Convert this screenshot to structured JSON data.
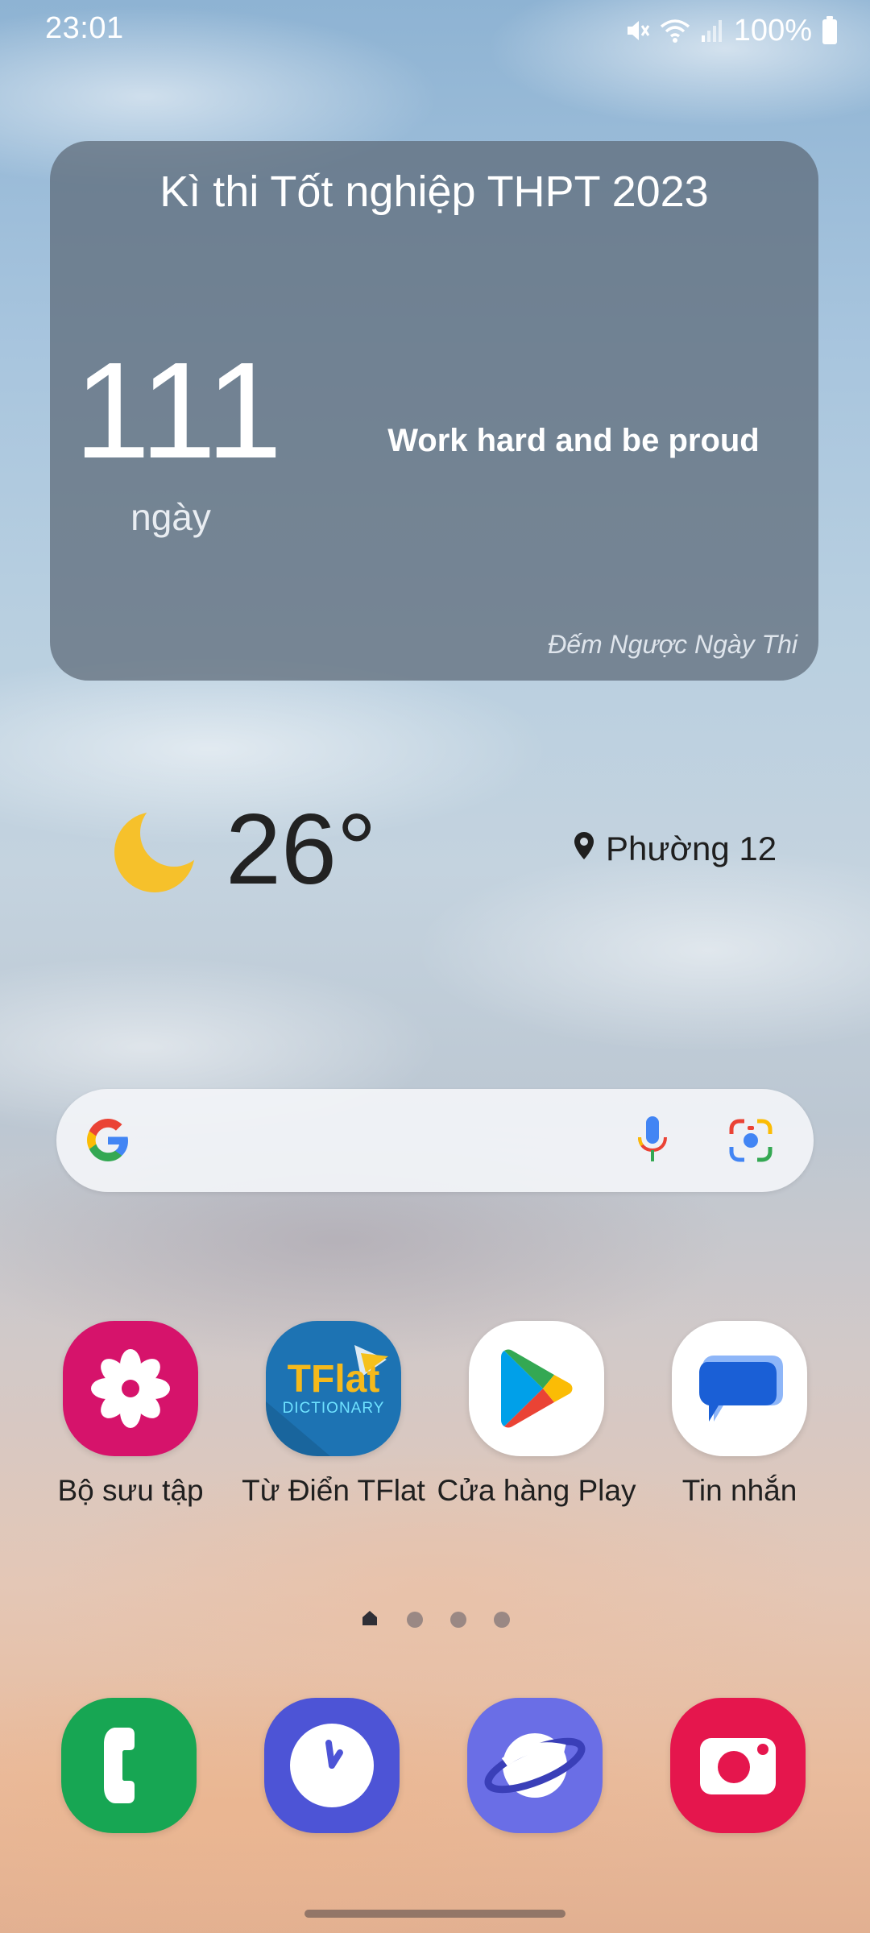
{
  "status_bar": {
    "time": "23:01",
    "battery_text": "100%",
    "icons": [
      "mute-icon",
      "wifi-icon",
      "signal-icon",
      "battery-icon"
    ]
  },
  "countdown_widget": {
    "title": "Kì thi Tốt nghiệp THPT 2023",
    "days": "111",
    "unit": "ngày",
    "motto": "Work hard and be proud",
    "app_name": "Đếm Ngược Ngày Thi"
  },
  "weather_widget": {
    "icon": "moon-icon",
    "temperature": "26°",
    "location": "Phường 12"
  },
  "search_bar": {
    "icons": [
      "google-logo-icon",
      "microphone-icon",
      "google-lens-icon"
    ]
  },
  "apps": [
    {
      "label": "Bộ sưu tập",
      "icon": "gallery-icon",
      "color": "#d6136b"
    },
    {
      "label": "Từ Điển TFlat",
      "icon": "tflat-dictionary-icon",
      "color": "#1d73b3",
      "icon_text_top": "TFlat",
      "icon_text_bottom": "DICTIONARY"
    },
    {
      "label": "Cửa hàng Play",
      "icon": "play-store-icon",
      "color": "#ffffff"
    },
    {
      "label": "Tin nhắn",
      "icon": "messages-icon",
      "color": "#ffffff"
    }
  ],
  "dock": [
    {
      "name": "phone",
      "icon": "phone-icon",
      "color": "#17a653"
    },
    {
      "name": "clock",
      "icon": "clock-icon",
      "color": "#4d54d6"
    },
    {
      "name": "internet",
      "icon": "internet-icon",
      "color": "#6a6ee6"
    },
    {
      "name": "camera",
      "icon": "camera-icon",
      "color": "#e5164d"
    }
  ],
  "pager": {
    "pages": 4,
    "current": 1
  }
}
